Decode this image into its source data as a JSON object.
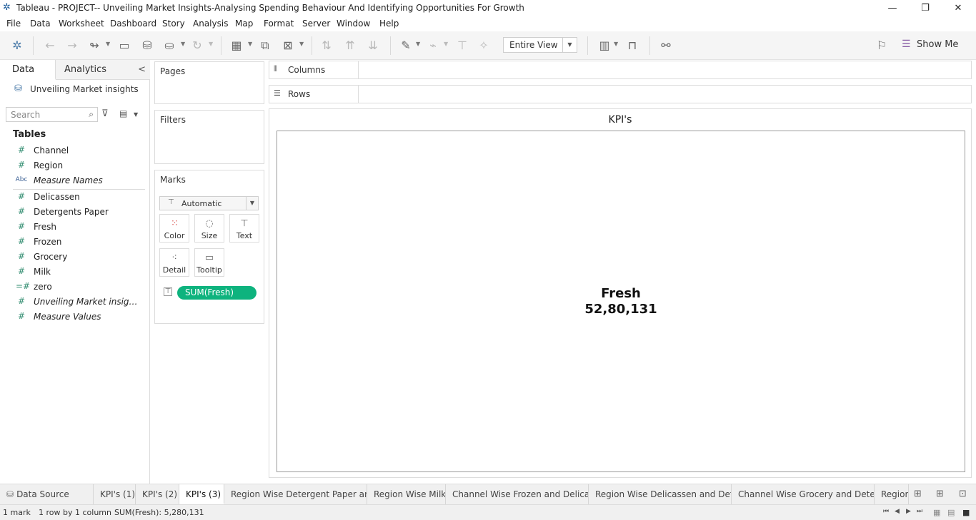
{
  "window": {
    "title": "Tableau - PROJECT-- Unveiling Market Insights-Analysing Spending Behaviour And Identifying Opportunities For Growth"
  },
  "menu": [
    "File",
    "Data",
    "Worksheet",
    "Dashboard",
    "Story",
    "Analysis",
    "Map",
    "Format",
    "Server",
    "Window",
    "Help"
  ],
  "toolbar": {
    "fit_value": "Entire View",
    "show_me_label": "Show Me"
  },
  "data_pane": {
    "tab_data": "Data",
    "tab_analytics": "Analytics",
    "datasource": "Unveiling Market insights",
    "search_placeholder": "Search",
    "tables_header": "Tables",
    "fields": [
      {
        "name": "Channel",
        "type": "#",
        "italic": false
      },
      {
        "name": "Region",
        "type": "#",
        "italic": false
      },
      {
        "name": "Measure Names",
        "type": "Abc",
        "italic": true
      },
      {
        "name": "Delicassen",
        "type": "#",
        "italic": false
      },
      {
        "name": "Detergents Paper",
        "type": "#",
        "italic": false
      },
      {
        "name": "Fresh",
        "type": "#",
        "italic": false
      },
      {
        "name": "Frozen",
        "type": "#",
        "italic": false
      },
      {
        "name": "Grocery",
        "type": "#",
        "italic": false
      },
      {
        "name": "Milk",
        "type": "#",
        "italic": false
      },
      {
        "name": "zero",
        "type": "=#",
        "italic": false
      },
      {
        "name": "Unveiling Market insights....",
        "type": "#",
        "italic": true
      },
      {
        "name": "Measure Values",
        "type": "#",
        "italic": true
      }
    ]
  },
  "cards": {
    "pages": "Pages",
    "filters": "Filters",
    "marks": "Marks",
    "marks_type": "Automatic",
    "marks_buttons": {
      "color": "Color",
      "size": "Size",
      "text": "Text",
      "detail": "Detail",
      "tooltip": "Tooltip"
    },
    "pill": "SUM(Fresh)"
  },
  "shelves": {
    "columns": "Columns",
    "rows": "Rows"
  },
  "view": {
    "title": "KPI's",
    "kpi_label": "Fresh",
    "kpi_value": "52,80,131"
  },
  "sheet_tabs": {
    "data_source": "Data Source",
    "tabs": [
      "KPI's (1)",
      "KPI's (2)",
      "KPI's (3)",
      "Region Wise Detergent Paper an...",
      "Region Wise Milk",
      "Channel Wise Frozen and Delica...",
      "Region Wise Delicassen and Det...",
      "Channel Wise Grocery and Deter...",
      "Region"
    ],
    "active_index": 2
  },
  "status": {
    "marks": "1 mark",
    "dims": "1 row by 1 column",
    "sum": "SUM(Fresh): 5,280,131"
  },
  "colors": {
    "pill": "#0eb37e",
    "field_icon": "#2e8b6e"
  }
}
